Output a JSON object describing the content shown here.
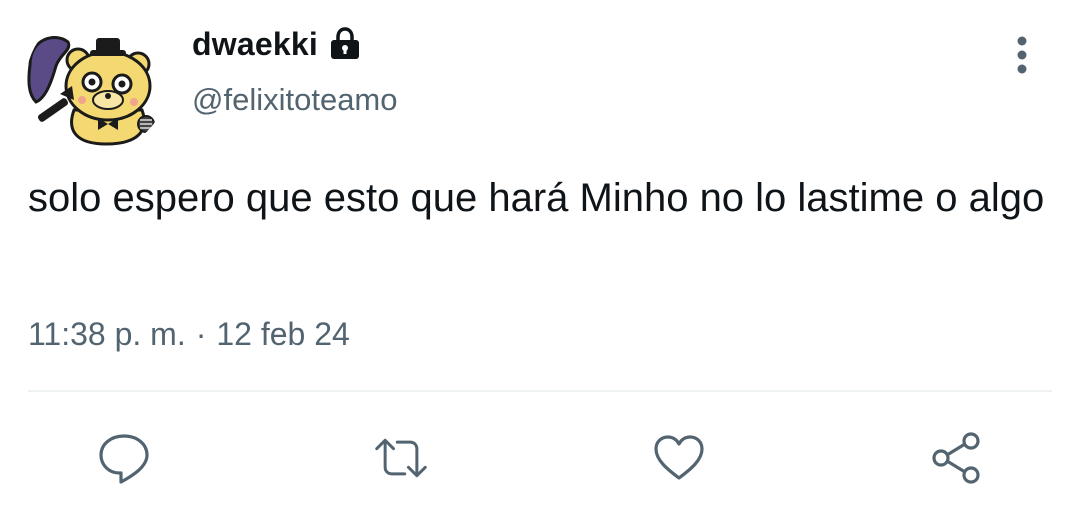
{
  "author": {
    "display_name": "dwaekki",
    "handle": "@felixitoteamo",
    "locked": true,
    "avatar_icon": "cartoon-bear-avatar"
  },
  "tweet": {
    "text": "solo espero que esto que hará Minho no lo lastime o algo",
    "time": "11:38 p. m.",
    "separator": "·",
    "date": "12 feb 24"
  },
  "actions": {
    "icons": [
      "reply-icon",
      "retweet-icon",
      "like-icon",
      "share-icon"
    ]
  },
  "menu": {
    "icon": "more-vertical-icon"
  },
  "colors": {
    "text_primary": "#0f1419",
    "text_secondary": "#536471",
    "icon_gray": "#536471",
    "divider": "#eff3f4"
  }
}
